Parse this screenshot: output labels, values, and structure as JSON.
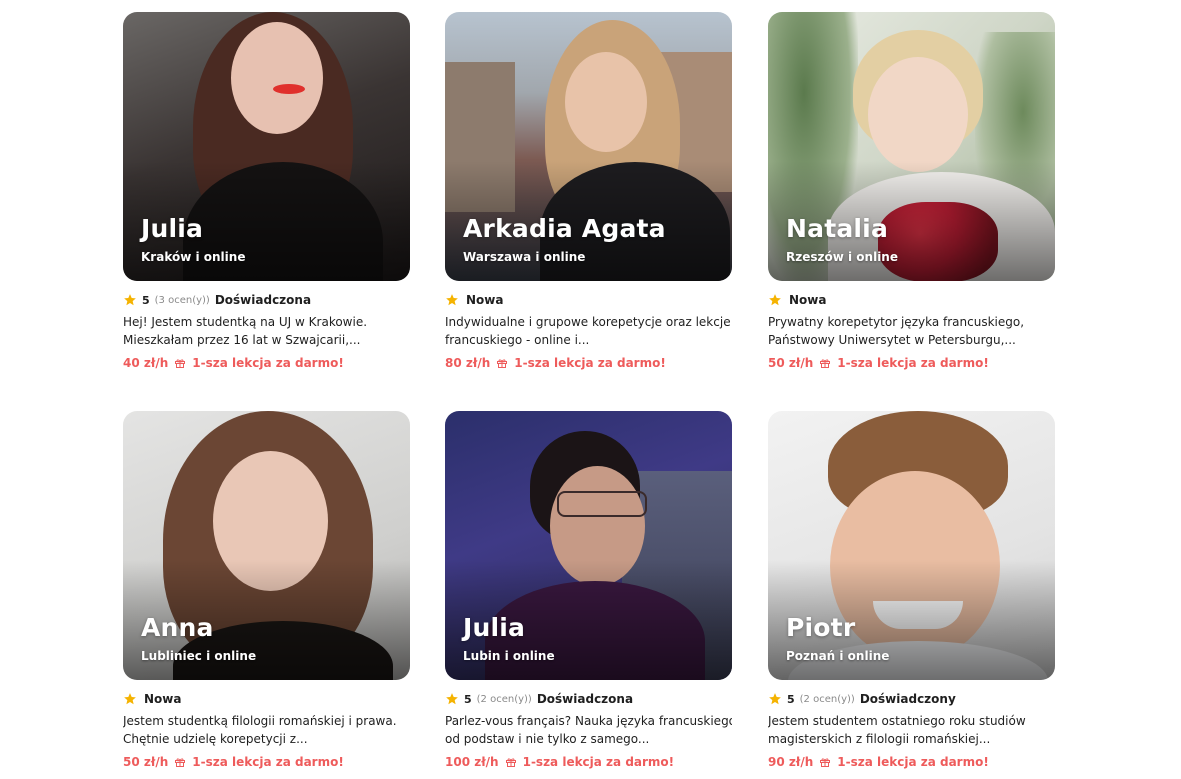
{
  "colors": {
    "accent": "#ee5b5b",
    "star": "#f5b301",
    "muted": "#8a8a8a"
  },
  "tutors": [
    {
      "name": "Julia",
      "location": "Kraków i online",
      "rating": "5",
      "reviews": "(3 ocen(y))",
      "level": "Doświadczona",
      "desc_line1": "Hej! Jestem studentką na UJ w Krakowie.",
      "desc_line2": "Mieszkałam przez 16 lat w Szwajcarii,...",
      "price": "40 zł/h",
      "offer": "1-sza lekcja za darmo!"
    },
    {
      "name": "Arkadia Agata",
      "location": "Warszawa i online",
      "rating": "",
      "reviews": "",
      "level": "Nowa",
      "desc_line1": "Indywidualne i grupowe korepetycje oraz lekcje j.",
      "desc_line2": "francuskiego - online i...",
      "price": "80 zł/h",
      "offer": "1-sza lekcja za darmo!"
    },
    {
      "name": "Natalia",
      "location": "Rzeszów i online",
      "rating": "",
      "reviews": "",
      "level": "Nowa",
      "desc_line1": "Prywatny korepetytor języka francuskiego,",
      "desc_line2": "Państwowy Uniwersytet w Petersburgu,...",
      "price": "50 zł/h",
      "offer": "1-sza lekcja za darmo!"
    },
    {
      "name": "Anna",
      "location": "Lubliniec i online",
      "rating": "",
      "reviews": "",
      "level": "Nowa",
      "desc_line1": "Jestem studentką filologii romańskiej i prawa.",
      "desc_line2": "Chętnie udzielę korepetycji z...",
      "price": "50 zł/h",
      "offer": "1-sza lekcja za darmo!"
    },
    {
      "name": "Julia",
      "location": "Lubin i online",
      "rating": "5",
      "reviews": "(2 ocen(y))",
      "level": "Doświadczona",
      "desc_line1": "Parlez-vous français? Nauka języka francuskiego",
      "desc_line2": "od podstaw i nie tylko z samego...",
      "price": "100 zł/h",
      "offer": "1-sza lekcja za darmo!"
    },
    {
      "name": "Piotr",
      "location": "Poznań i online",
      "rating": "5",
      "reviews": "(2 ocen(y))",
      "level": "Doświadczony",
      "desc_line1": "Jestem studentem ostatniego roku studiów",
      "desc_line2": "magisterskich z filologii romańskiej...",
      "price": "90 zł/h",
      "offer": "1-sza lekcja za darmo!"
    }
  ]
}
